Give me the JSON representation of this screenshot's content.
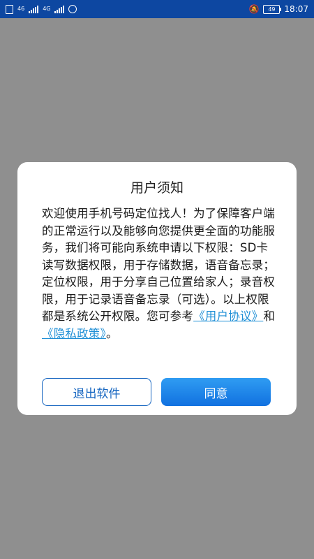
{
  "status_bar": {
    "left": [
      "46",
      "4G"
    ],
    "time": "18:07",
    "battery": "49",
    "icons": [
      "sim-icon",
      "signal-icon",
      "alarm-icon",
      "mute-icon",
      "battery-icon"
    ]
  },
  "dialog": {
    "title": "用户须知",
    "content_plain": "欢迎使用手机号码定位找人！为了保障客户端的正常运行以及能够向您提供更全面的功能服务，我们将可能向系统申请以下权限：SD卡读写数据权限，用于存储数据，语音备忘录；定位权限，用于分享自己位置给家人；录音权限，用于记录语音备忘录（可选）。以上权限都是系统公开权限。您可参考",
    "user_agreement_link": "《用户协议》",
    "conjunction": "和",
    "privacy_policy_link": "《隐私政策》",
    "end_punct": "。",
    "buttons": {
      "exit": "退出软件",
      "agree": "同意"
    }
  },
  "colors": {
    "status_bar": "#0d47a1",
    "overlay": "#8f8f8f",
    "accent": "#1f8fd6",
    "primary_button": "#1171e0"
  }
}
